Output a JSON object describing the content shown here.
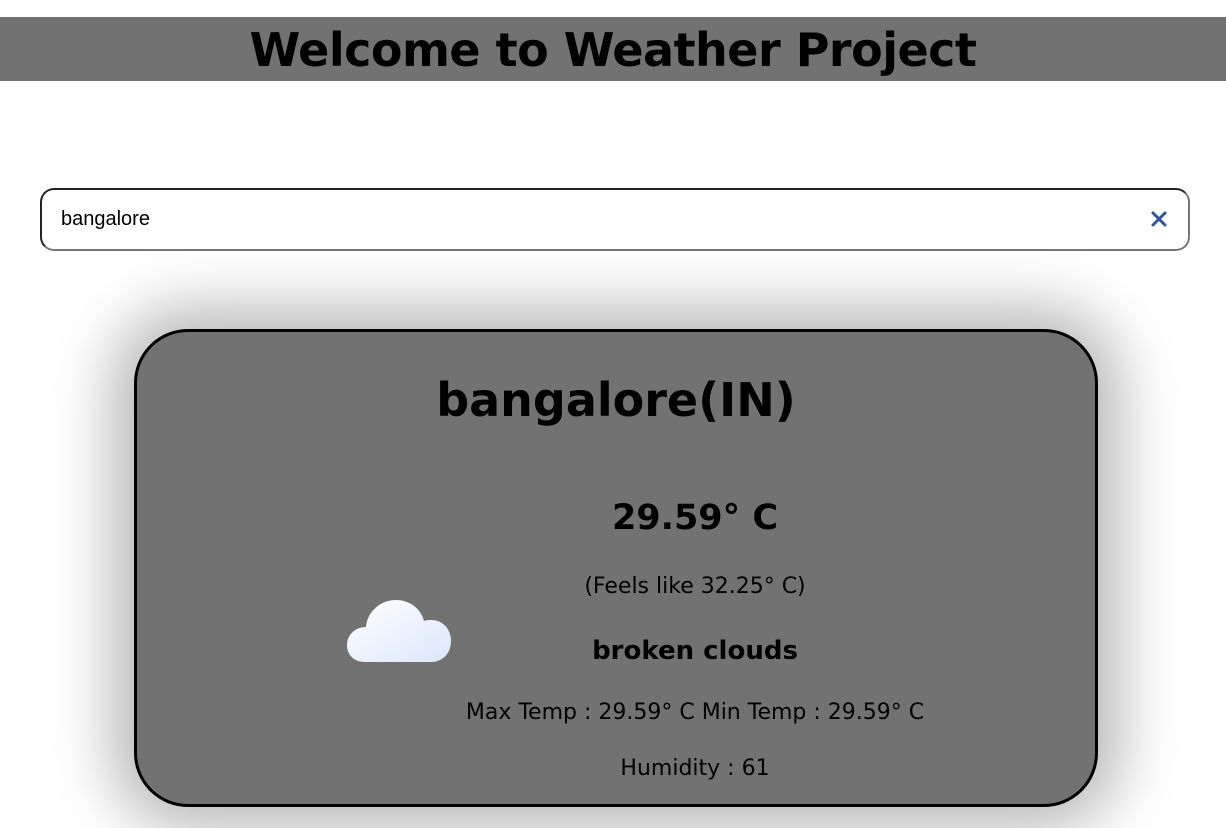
{
  "header": {
    "title": "Welcome to Weather Project"
  },
  "search": {
    "value": "bangalore",
    "clear_icon": "close-icon"
  },
  "weather": {
    "city": "bangalore(IN)",
    "icon": "cloud-icon",
    "temperature": "29.59° C",
    "feels_like": "(Feels like 32.25° C)",
    "description": "broken clouds",
    "min_max": "Max Temp : 29.59° C Min Temp : 29.59° C",
    "humidity": "Humidity : 61"
  },
  "colors": {
    "header_bg": "#727272",
    "card_bg": "#727272",
    "clear_icon": "#2f5597"
  }
}
